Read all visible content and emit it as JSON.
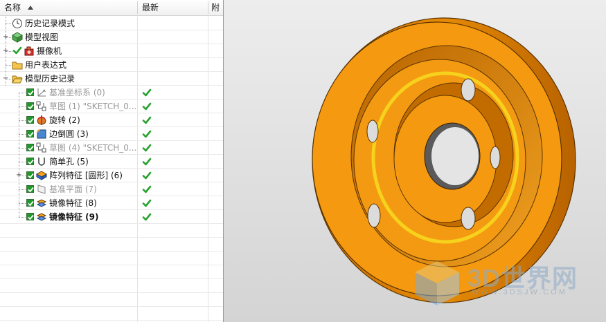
{
  "header": {
    "name_col": "名称",
    "latest_col": "最新",
    "third_col": "附"
  },
  "tree": [
    {
      "label": "历史记录模式",
      "icon": "clock-icon",
      "style": "normal",
      "check": false
    },
    {
      "label": "模型视图",
      "icon": "model-view-icon",
      "style": "normal",
      "check": false
    },
    {
      "label": "摄像机",
      "icon": "camera-icon",
      "style": "normal",
      "check": false
    },
    {
      "label": "用户表达式",
      "icon": "folder-icon",
      "style": "normal",
      "check": false
    },
    {
      "label": "模型历史记录",
      "icon": "folder-open-icon",
      "style": "normal",
      "check": false
    },
    {
      "label": "基准坐标系 (0)",
      "icon": "datum-csys-icon",
      "style": "grey",
      "check": true
    },
    {
      "label": "草图 (1) \"SKETCH_0...",
      "icon": "sketch-icon",
      "style": "grey",
      "check": true
    },
    {
      "label": "旋转 (2)",
      "icon": "revolve-icon",
      "style": "normal",
      "check": true
    },
    {
      "label": "边倒圆 (3)",
      "icon": "edge-blend-icon",
      "style": "normal",
      "check": true
    },
    {
      "label": "草图 (4) \"SKETCH_0...",
      "icon": "sketch-icon",
      "style": "grey",
      "check": true
    },
    {
      "label": "简单孔 (5)",
      "icon": "simple-hole-icon",
      "style": "normal",
      "check": true
    },
    {
      "label": "阵列特征 [圆形] (6)",
      "icon": "pattern-feature-icon",
      "style": "normal",
      "check": true
    },
    {
      "label": "基准平面 (7)",
      "icon": "datum-plane-icon",
      "style": "grey",
      "check": true
    },
    {
      "label": "镜像特征 (8)",
      "icon": "mirror-feature-icon",
      "style": "normal",
      "check": true
    },
    {
      "label": "镜像特征 (9)",
      "icon": "mirror-feature-icon",
      "style": "bold",
      "check": true
    }
  ],
  "watermark": {
    "brand": "3D世界网",
    "url": "WWW.3DSJW.COM"
  },
  "colors": {
    "part": "#f59a0f",
    "check_green": "#27a12e",
    "viewport_bg": "#e3e3e3"
  }
}
